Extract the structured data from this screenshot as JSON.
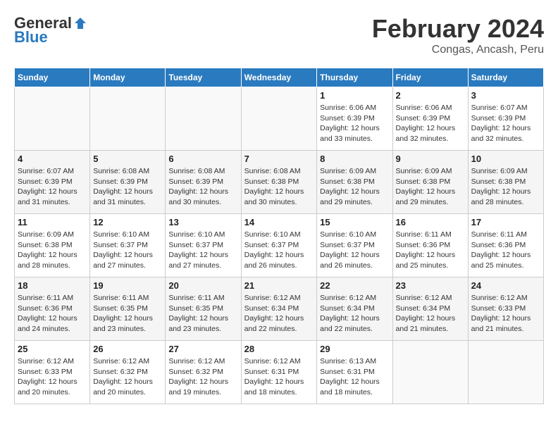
{
  "header": {
    "logo_general": "General",
    "logo_blue": "Blue",
    "month_title": "February 2024",
    "location": "Congas, Ancash, Peru"
  },
  "weekdays": [
    "Sunday",
    "Monday",
    "Tuesday",
    "Wednesday",
    "Thursday",
    "Friday",
    "Saturday"
  ],
  "weeks": [
    [
      {
        "day": "",
        "info": ""
      },
      {
        "day": "",
        "info": ""
      },
      {
        "day": "",
        "info": ""
      },
      {
        "day": "",
        "info": ""
      },
      {
        "day": "1",
        "info": "Sunrise: 6:06 AM\nSunset: 6:39 PM\nDaylight: 12 hours\nand 33 minutes."
      },
      {
        "day": "2",
        "info": "Sunrise: 6:06 AM\nSunset: 6:39 PM\nDaylight: 12 hours\nand 32 minutes."
      },
      {
        "day": "3",
        "info": "Sunrise: 6:07 AM\nSunset: 6:39 PM\nDaylight: 12 hours\nand 32 minutes."
      }
    ],
    [
      {
        "day": "4",
        "info": "Sunrise: 6:07 AM\nSunset: 6:39 PM\nDaylight: 12 hours\nand 31 minutes."
      },
      {
        "day": "5",
        "info": "Sunrise: 6:08 AM\nSunset: 6:39 PM\nDaylight: 12 hours\nand 31 minutes."
      },
      {
        "day": "6",
        "info": "Sunrise: 6:08 AM\nSunset: 6:39 PM\nDaylight: 12 hours\nand 30 minutes."
      },
      {
        "day": "7",
        "info": "Sunrise: 6:08 AM\nSunset: 6:38 PM\nDaylight: 12 hours\nand 30 minutes."
      },
      {
        "day": "8",
        "info": "Sunrise: 6:09 AM\nSunset: 6:38 PM\nDaylight: 12 hours\nand 29 minutes."
      },
      {
        "day": "9",
        "info": "Sunrise: 6:09 AM\nSunset: 6:38 PM\nDaylight: 12 hours\nand 29 minutes."
      },
      {
        "day": "10",
        "info": "Sunrise: 6:09 AM\nSunset: 6:38 PM\nDaylight: 12 hours\nand 28 minutes."
      }
    ],
    [
      {
        "day": "11",
        "info": "Sunrise: 6:09 AM\nSunset: 6:38 PM\nDaylight: 12 hours\nand 28 minutes."
      },
      {
        "day": "12",
        "info": "Sunrise: 6:10 AM\nSunset: 6:37 PM\nDaylight: 12 hours\nand 27 minutes."
      },
      {
        "day": "13",
        "info": "Sunrise: 6:10 AM\nSunset: 6:37 PM\nDaylight: 12 hours\nand 27 minutes."
      },
      {
        "day": "14",
        "info": "Sunrise: 6:10 AM\nSunset: 6:37 PM\nDaylight: 12 hours\nand 26 minutes."
      },
      {
        "day": "15",
        "info": "Sunrise: 6:10 AM\nSunset: 6:37 PM\nDaylight: 12 hours\nand 26 minutes."
      },
      {
        "day": "16",
        "info": "Sunrise: 6:11 AM\nSunset: 6:36 PM\nDaylight: 12 hours\nand 25 minutes."
      },
      {
        "day": "17",
        "info": "Sunrise: 6:11 AM\nSunset: 6:36 PM\nDaylight: 12 hours\nand 25 minutes."
      }
    ],
    [
      {
        "day": "18",
        "info": "Sunrise: 6:11 AM\nSunset: 6:36 PM\nDaylight: 12 hours\nand 24 minutes."
      },
      {
        "day": "19",
        "info": "Sunrise: 6:11 AM\nSunset: 6:35 PM\nDaylight: 12 hours\nand 23 minutes."
      },
      {
        "day": "20",
        "info": "Sunrise: 6:11 AM\nSunset: 6:35 PM\nDaylight: 12 hours\nand 23 minutes."
      },
      {
        "day": "21",
        "info": "Sunrise: 6:12 AM\nSunset: 6:34 PM\nDaylight: 12 hours\nand 22 minutes."
      },
      {
        "day": "22",
        "info": "Sunrise: 6:12 AM\nSunset: 6:34 PM\nDaylight: 12 hours\nand 22 minutes."
      },
      {
        "day": "23",
        "info": "Sunrise: 6:12 AM\nSunset: 6:34 PM\nDaylight: 12 hours\nand 21 minutes."
      },
      {
        "day": "24",
        "info": "Sunrise: 6:12 AM\nSunset: 6:33 PM\nDaylight: 12 hours\nand 21 minutes."
      }
    ],
    [
      {
        "day": "25",
        "info": "Sunrise: 6:12 AM\nSunset: 6:33 PM\nDaylight: 12 hours\nand 20 minutes."
      },
      {
        "day": "26",
        "info": "Sunrise: 6:12 AM\nSunset: 6:32 PM\nDaylight: 12 hours\nand 20 minutes."
      },
      {
        "day": "27",
        "info": "Sunrise: 6:12 AM\nSunset: 6:32 PM\nDaylight: 12 hours\nand 19 minutes."
      },
      {
        "day": "28",
        "info": "Sunrise: 6:12 AM\nSunset: 6:31 PM\nDaylight: 12 hours\nand 18 minutes."
      },
      {
        "day": "29",
        "info": "Sunrise: 6:13 AM\nSunset: 6:31 PM\nDaylight: 12 hours\nand 18 minutes."
      },
      {
        "day": "",
        "info": ""
      },
      {
        "day": "",
        "info": ""
      }
    ]
  ]
}
